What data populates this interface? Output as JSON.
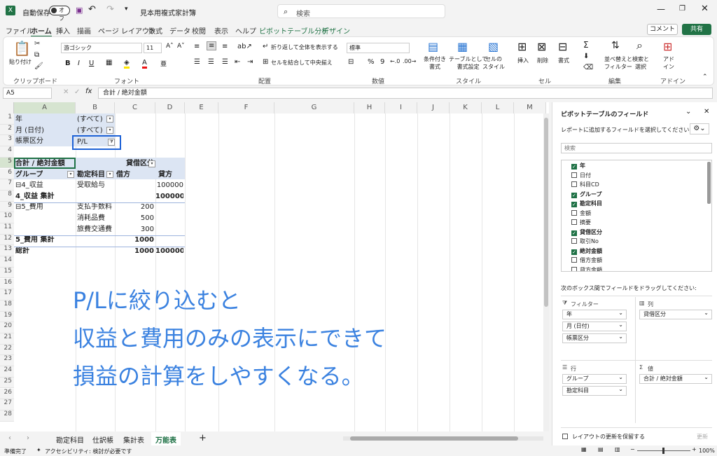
{
  "titlebar": {
    "autosave_label": "自動保存",
    "autosave_state": "オフ",
    "filename": "見本用複式家計簿",
    "search_placeholder": "検索"
  },
  "menu": {
    "tabs": [
      "ファイル",
      "ホーム",
      "挿入",
      "描画",
      "ページ レイアウト",
      "数式",
      "データ",
      "校閲",
      "表示",
      "ヘルプ",
      "ピボットテーブル分析",
      "デザイン"
    ],
    "comment": "コメント",
    "share": "共有"
  },
  "ribbon": {
    "paste": "貼り付け",
    "font_name": "游ゴシック",
    "font_size": "11",
    "wrap": "折り返して全体を表示する",
    "merge": "セルを結合して中央揃え",
    "number_format": "標準",
    "cond_format": "条件付き\n書式",
    "table_format": "テーブルとして\n書式設定",
    "cell_style": "セルの\nスタイル",
    "insert": "挿入",
    "delete": "削除",
    "format": "書式",
    "sort": "並べ替えと\nフィルター",
    "find": "検索と\n選択",
    "addin": "アド\nイン",
    "groups": {
      "clipboard": "クリップボード",
      "font": "フォント",
      "align": "配置",
      "number": "数値",
      "style": "スタイル",
      "cells": "セル",
      "edit": "編集",
      "addins": "アドイン"
    }
  },
  "formula": {
    "namebox": "A5",
    "content": "合計 / 絶対金額"
  },
  "columns": [
    "A",
    "B",
    "C",
    "D",
    "E",
    "F",
    "G",
    "H",
    "I",
    "J",
    "K",
    "L",
    "M"
  ],
  "rows": [
    "1",
    "2",
    "3",
    "4",
    "5",
    "6",
    "7",
    "8",
    "9",
    "10",
    "11",
    "12",
    "13",
    "14",
    "15",
    "16",
    "17",
    "18",
    "19",
    "20",
    "21",
    "22",
    "23",
    "24",
    "25",
    "26",
    "27",
    "28"
  ],
  "pivot": {
    "filters": [
      {
        "label": "年",
        "value": "(すべて)"
      },
      {
        "label": "月 (日付)",
        "value": "(すべて)"
      },
      {
        "label": "帳票区分",
        "value": "P/L"
      }
    ],
    "header": {
      "sum": "合計 / 絶対金額",
      "col_field": "貸借区分",
      "group": "グループ",
      "account": "勘定科目",
      "debit": "借方",
      "credit": "貸方"
    },
    "rows": [
      {
        "a": "⊟4_収益",
        "b": "受取給与",
        "c": "",
        "d": "100000",
        "bold": false
      },
      {
        "a": "4_収益 集計",
        "b": "",
        "c": "",
        "d": "100000",
        "bold": true
      },
      {
        "a": "⊟5_費用",
        "b": "支払手数料",
        "c": "200",
        "d": "",
        "bold": false
      },
      {
        "a": "",
        "b": "消耗品費",
        "c": "500",
        "d": "",
        "bold": false
      },
      {
        "a": "",
        "b": "旅費交通費",
        "c": "300",
        "d": "",
        "bold": false
      },
      {
        "a": "5_費用 集計",
        "b": "",
        "c": "1000",
        "d": "",
        "bold": true
      },
      {
        "a": "総計",
        "b": "",
        "c": "1000",
        "d": "100000",
        "bold": true
      }
    ]
  },
  "overlay": {
    "line1": "P/Lに絞り込むと",
    "line2": "収益と費用のみの表示にできて",
    "line3": "損益の計算をしやすくなる。"
  },
  "sheet_tabs": [
    "勘定科目",
    "仕訳帳",
    "集計表",
    "万能表"
  ],
  "active_tab": "万能表",
  "status": {
    "ready": "準備完了",
    "accessibility": "アクセシビリティ: 検討が必要です",
    "zoom": "100%"
  },
  "pane": {
    "title": "ピボットテーブルのフィールド",
    "subtitle": "レポートに追加するフィールドを選択してください:",
    "search": "検索",
    "fields": [
      {
        "name": "年",
        "on": true
      },
      {
        "name": "日付",
        "on": false
      },
      {
        "name": "科目CD",
        "on": false
      },
      {
        "name": "グループ",
        "on": true
      },
      {
        "name": "勘定科目",
        "on": true
      },
      {
        "name": "金額",
        "on": false
      },
      {
        "name": "摘要",
        "on": false
      },
      {
        "name": "貸借区分",
        "on": true
      },
      {
        "name": "取引No",
        "on": false
      },
      {
        "name": "絶対金額",
        "on": true
      },
      {
        "name": "借方金額",
        "on": false
      },
      {
        "name": "貸方金額",
        "on": false
      }
    ],
    "drag_label": "次のボックス間でフィールドをドラッグしてください:",
    "filter_title": "フィルター",
    "filter_items": [
      "年",
      "月 (日付)",
      "帳票区分"
    ],
    "column_title": "列",
    "column_items": [
      "貸借区分"
    ],
    "row_title": "行",
    "row_items": [
      "グループ",
      "勘定科目"
    ],
    "value_title": "値",
    "value_items": [
      "合計 / 絶対金額"
    ],
    "defer": "レイアウトの更新を保留する",
    "update": "更新"
  },
  "accent": "#217346",
  "overlay_color": "#3b82e0"
}
